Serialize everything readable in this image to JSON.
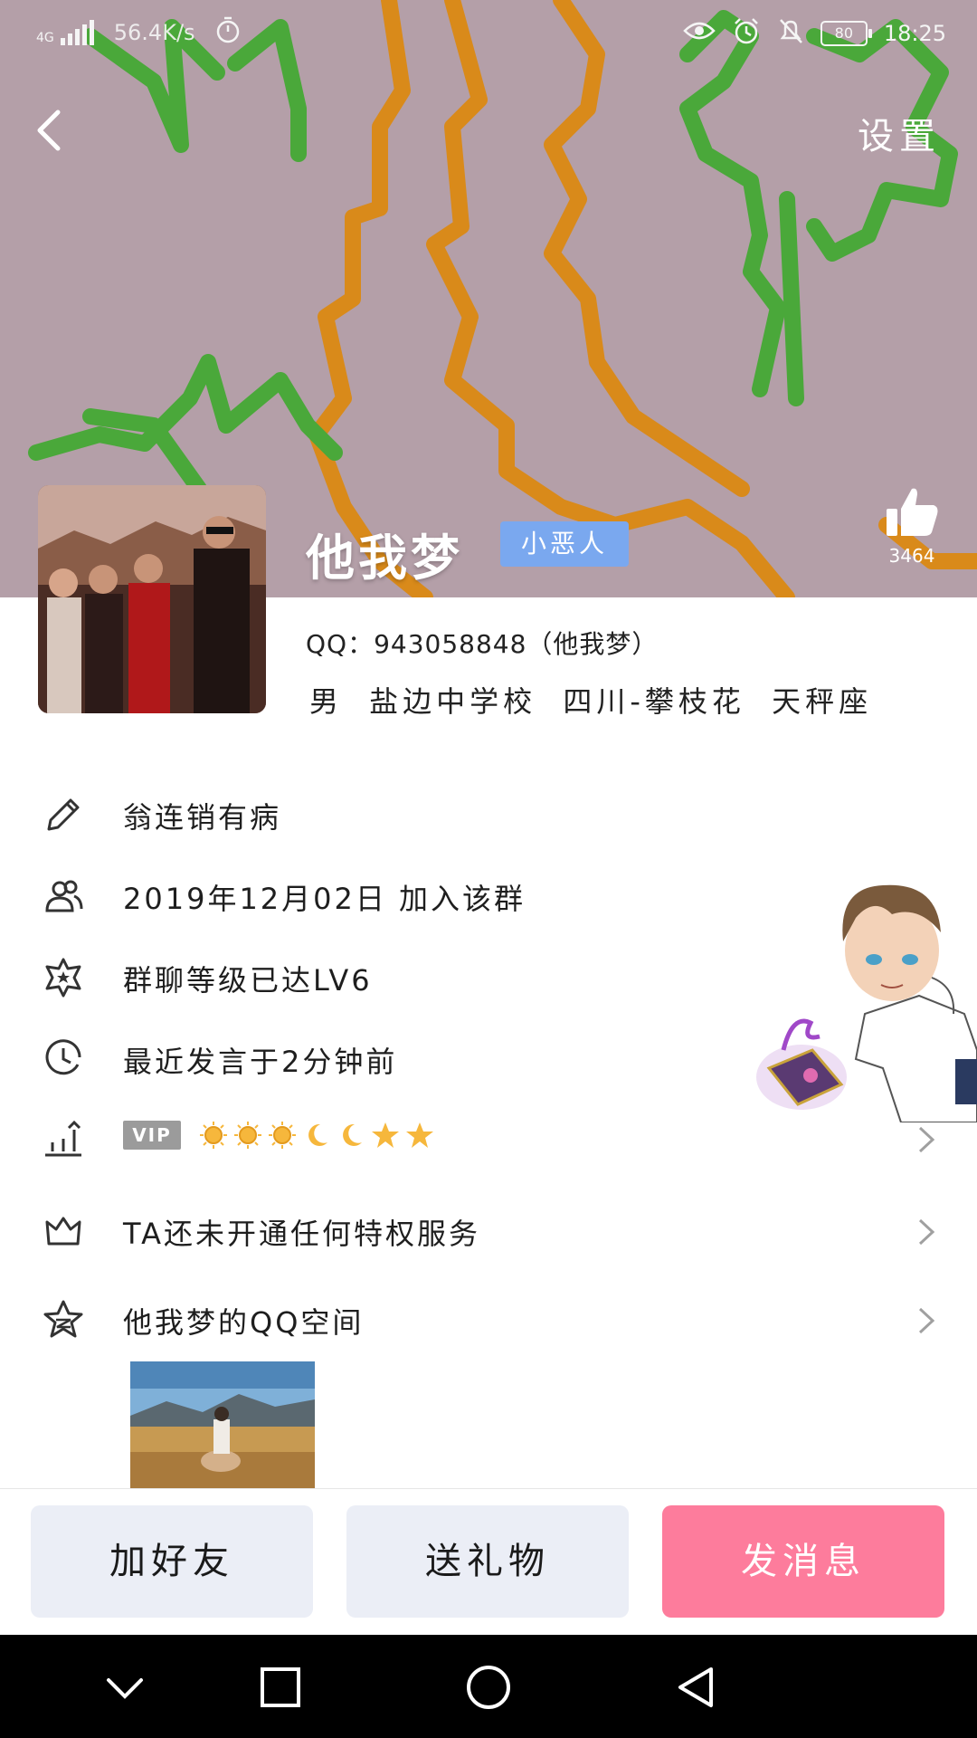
{
  "status_bar": {
    "network_type": "4G",
    "speed": "56.4K/s",
    "battery": "80",
    "time": "18:25"
  },
  "header": {
    "settings_label": "设置"
  },
  "profile": {
    "name": "他我梦",
    "tag": "小恶人",
    "likes": "3464",
    "qq_line": "QQ：943058848（他我梦）",
    "info_line": "男 盐边中学校 四川-攀枝花 天秤座"
  },
  "rows": {
    "signature": "翁连销有病",
    "joined": "2019年12月02日 加入该群",
    "level": "群聊等级已达LV6",
    "last_spoke": "最近发言于2分钟前",
    "vip_label": "VIP",
    "privilege": "TA还未开通任何特权服务",
    "qzone": "他我梦的QQ空间"
  },
  "actions": {
    "add_friend": "加好友",
    "send_gift": "送礼物",
    "send_message": "发消息"
  },
  "colors": {
    "cover_bg": "#b49fa8",
    "tag_bg": "#7aa8ef",
    "pink_button": "#fd7c9c",
    "gray_button": "#ebeef6"
  },
  "icons": {
    "level_badges": [
      "sun",
      "sun",
      "sun",
      "moon",
      "moon",
      "star",
      "star"
    ]
  }
}
